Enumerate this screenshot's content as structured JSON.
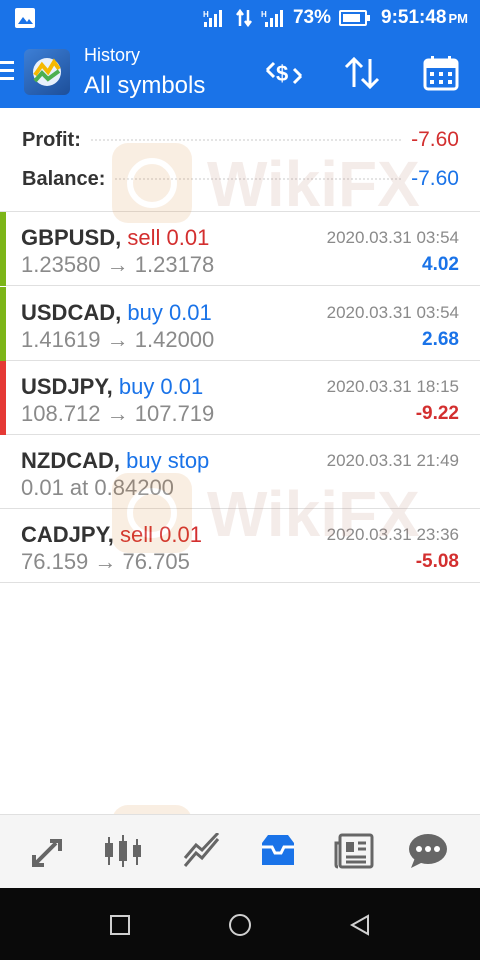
{
  "status_bar": {
    "battery": "73%",
    "time": "9:51:48",
    "time_suffix": "PM"
  },
  "app_bar": {
    "title": "History",
    "subtitle": "All symbols"
  },
  "summary": {
    "profit_label": "Profit:",
    "profit_value": "-7.60",
    "balance_label": "Balance:",
    "balance_value": "-7.60"
  },
  "trades": [
    {
      "symbol": "GBPUSD,",
      "side": "sell 0.01",
      "side_type": "sell",
      "prices": "1.23580 → 1.23178",
      "date": "2020.03.31 03:54",
      "pnl": "4.02",
      "pnl_color": "#1a73e8",
      "bar_color": "#7cb518"
    },
    {
      "symbol": "USDCAD,",
      "side": "buy 0.01",
      "side_type": "buy",
      "prices": "1.41619 → 1.42000",
      "date": "2020.03.31 03:54",
      "pnl": "2.68",
      "pnl_color": "#1a73e8",
      "bar_color": "#7cb518"
    },
    {
      "symbol": "USDJPY,",
      "side": "buy 0.01",
      "side_type": "buy",
      "prices": "108.712 → 107.719",
      "date": "2020.03.31 18:15",
      "pnl": "-9.22",
      "pnl_color": "#d32f2f",
      "bar_color": "#e53935"
    },
    {
      "symbol": "NZDCAD,",
      "side": "buy stop",
      "side_type": "buy",
      "prices": "0.01 at 0.84200",
      "date": "2020.03.31 21:49",
      "pnl": "",
      "pnl_color": "#1a73e8",
      "bar_color": "transparent"
    },
    {
      "symbol": "CADJPY,",
      "side": "sell 0.01",
      "side_type": "sell",
      "prices": "76.159 → 76.705",
      "date": "2020.03.31 23:36",
      "pnl": "-5.08",
      "pnl_color": "#d32f2f",
      "bar_color": "transparent"
    }
  ],
  "watermark_text": "WikiFX",
  "bottom_nav": [
    "quotes-icon",
    "chart-icon",
    "trade-icon",
    "history-icon",
    "news-icon",
    "messages-icon"
  ],
  "colors": {
    "brand_blue": "#1a73e8",
    "sell_red": "#d32f2f"
  }
}
